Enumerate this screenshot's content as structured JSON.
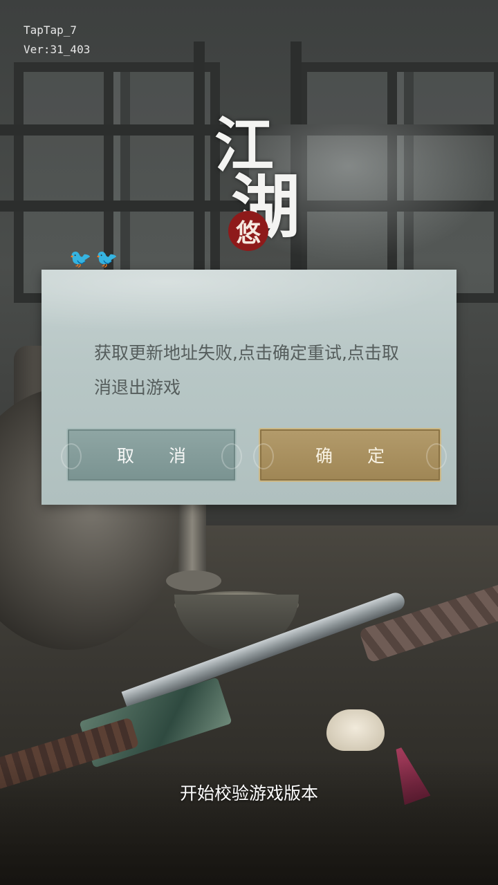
{
  "version": {
    "channel": "TapTap_7",
    "build": "Ver:31_403"
  },
  "logo": {
    "char1": "江",
    "char2": "湖",
    "seal": "悠"
  },
  "dialog": {
    "message": "获取更新地址失败,点击确定重试,点击取消退出游戏",
    "cancel_label": "取消",
    "confirm_label": "确定"
  },
  "status": {
    "text": "开始校验游戏版本"
  },
  "colors": {
    "dialog_bg": "#b8c7c6",
    "cancel_button": "#8fa6a4",
    "confirm_button": "#b39b6b",
    "message_text": "#555d5c"
  },
  "icons": [
    "bird-icon",
    "cloud-ornament-icon"
  ]
}
